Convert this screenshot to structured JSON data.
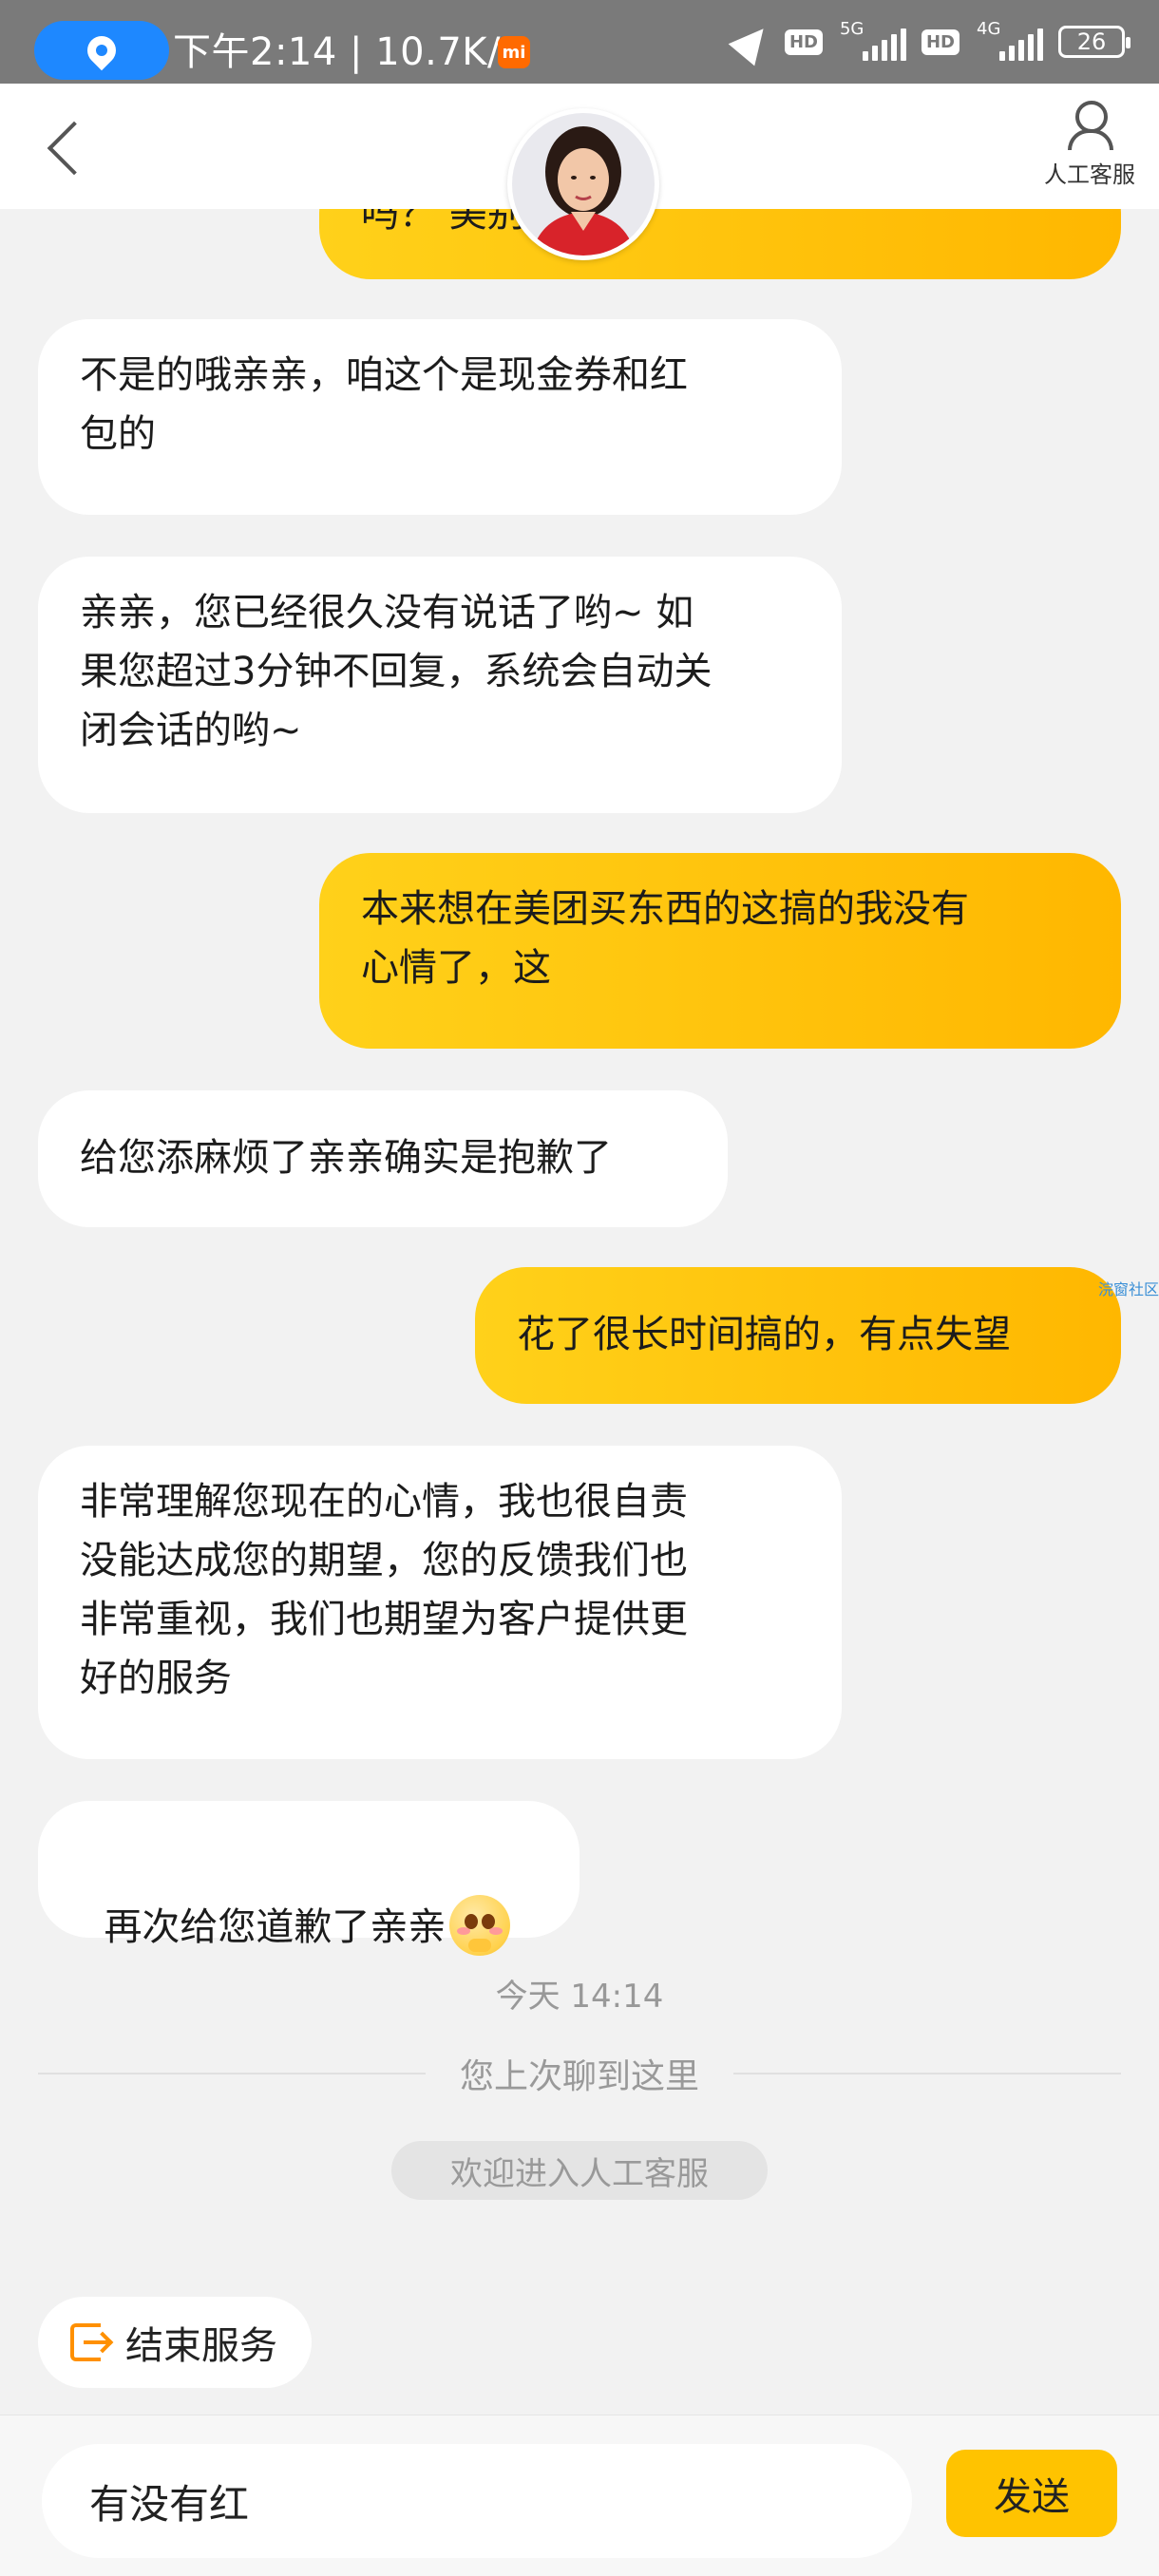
{
  "status_bar": {
    "time_speed": "下午2:14 | 10.7K/s",
    "mi_label": "mi",
    "hd1": "HD",
    "net1": "5G",
    "hd2": "HD",
    "net2": "4G",
    "battery": "26"
  },
  "header": {
    "service_label": "人工客服"
  },
  "messages": [
    {
      "role": "user",
      "text": "吗？ 美别"
    },
    {
      "role": "agent",
      "text": "不是的哦亲亲，咱这个是现金券和红\n包的"
    },
    {
      "role": "agent",
      "text": "亲亲，您已经很久没有说话了哟~ 如\n果您超过3分钟不回复，系统会自动关\n闭会话的哟~"
    },
    {
      "role": "user",
      "text": "本来想在美团买东西的这搞的我没有\n心情了，这"
    },
    {
      "role": "agent",
      "text": "给您添麻烦了亲亲确实是抱歉了"
    },
    {
      "role": "user",
      "text": "花了很长时间搞的，有点失望"
    },
    {
      "role": "agent",
      "text": "非常理解您现在的心情，我也很自责\n没能达成您的期望，您的反馈我们也\n非常重视，我们也期望为客户提供更\n好的服务"
    },
    {
      "role": "agent",
      "text": "再次给您道歉了亲亲",
      "emoji": "pleading-face"
    }
  ],
  "watermark": "浣窗社区",
  "timestamp": "今天 14:14",
  "divider_text": "您上次聊到这里",
  "system_notice": "欢迎进入人工客服",
  "end_service_label": "结束服务",
  "input": {
    "value": "有没有红",
    "send_label": "发送"
  },
  "colors": {
    "user_bubble_start": "#ffd11a",
    "user_bubble_end": "#ffb700",
    "accent": "#ffc300",
    "status_bar": "#7a7a7a"
  }
}
